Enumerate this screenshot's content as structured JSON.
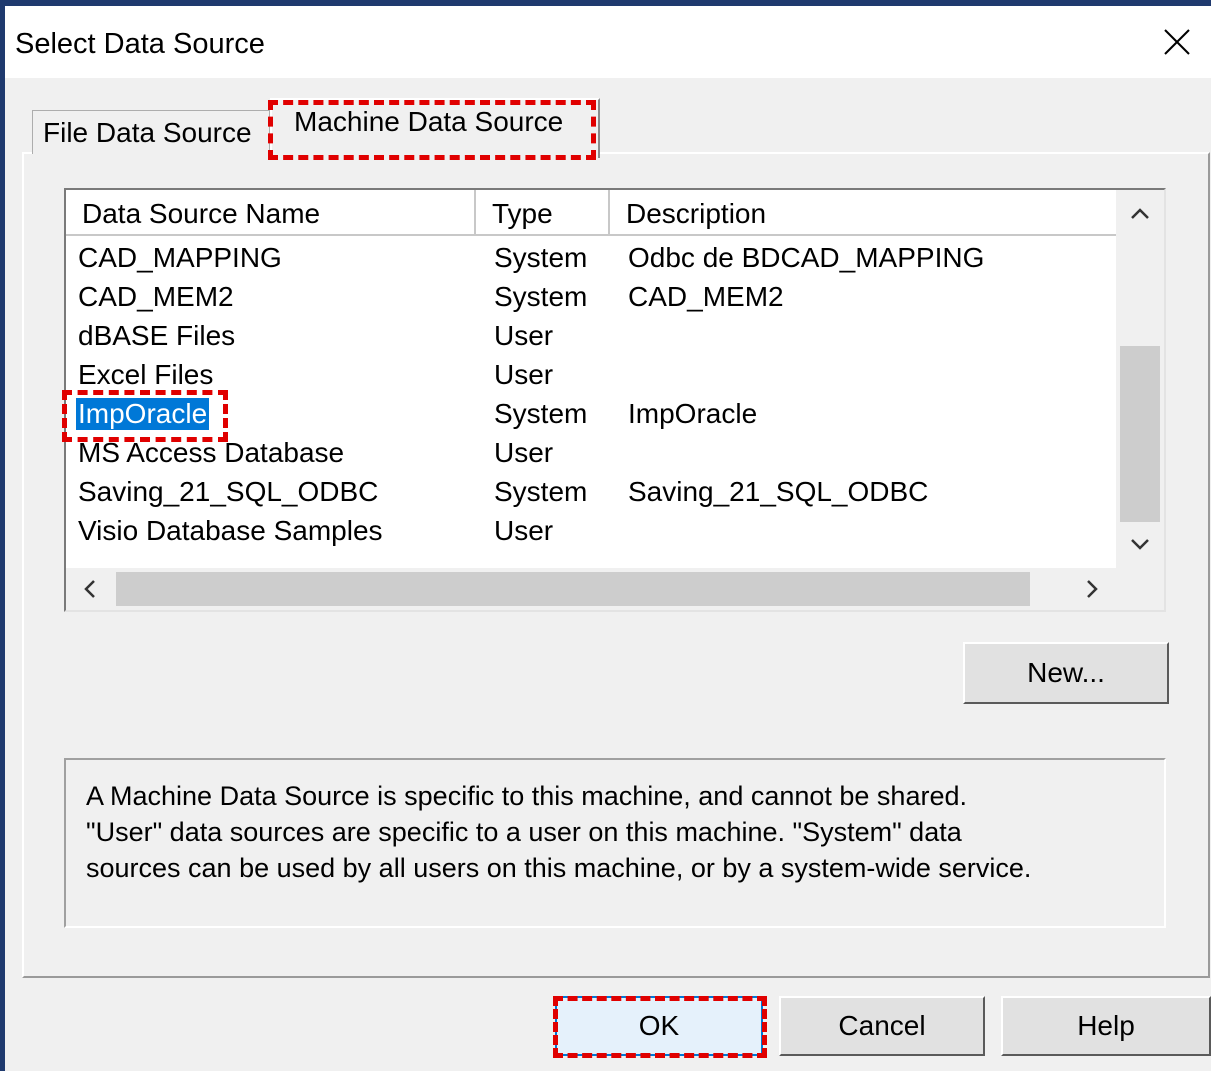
{
  "window": {
    "title": "Select Data Source"
  },
  "tabs": [
    {
      "label": "File Data Source",
      "active": false
    },
    {
      "label": "Machine Data Source",
      "active": true
    }
  ],
  "list": {
    "columns": [
      "Data Source Name",
      "Type",
      "Description"
    ],
    "rows": [
      {
        "name": "CAD_MAPPING",
        "type": "System",
        "description": "Odbc de BDCAD_MAPPING"
      },
      {
        "name": "CAD_MEM2",
        "type": "System",
        "description": "CAD_MEM2"
      },
      {
        "name": "dBASE Files",
        "type": "User",
        "description": ""
      },
      {
        "name": "Excel Files",
        "type": "User",
        "description": ""
      },
      {
        "name": "ImpOracle",
        "type": "System",
        "description": "ImpOracle",
        "selected": true
      },
      {
        "name": "MS Access Database",
        "type": "User",
        "description": ""
      },
      {
        "name": "Saving_21_SQL_ODBC",
        "type": "System",
        "description": "Saving_21_SQL_ODBC"
      },
      {
        "name": "Visio Database Samples",
        "type": "User",
        "description": ""
      }
    ]
  },
  "buttons": {
    "new": "New...",
    "ok": "OK",
    "cancel": "Cancel",
    "help": "Help"
  },
  "info": {
    "line1": "A Machine Data Source is specific to this machine, and cannot be shared.",
    "line2": "\"User\" data sources are specific to a user on this machine.  \"System\" data",
    "line3": "sources can be used by all users on this machine, or by a system-wide service."
  },
  "colors": {
    "selection": "#0078d7",
    "highlight": "#e00000",
    "frame": "#1f3a6e"
  },
  "icons": {
    "close": "close-icon",
    "scroll_up": "chevron-up-icon",
    "scroll_down": "chevron-down-icon",
    "scroll_left": "chevron-left-icon",
    "scroll_right": "chevron-right-icon"
  }
}
